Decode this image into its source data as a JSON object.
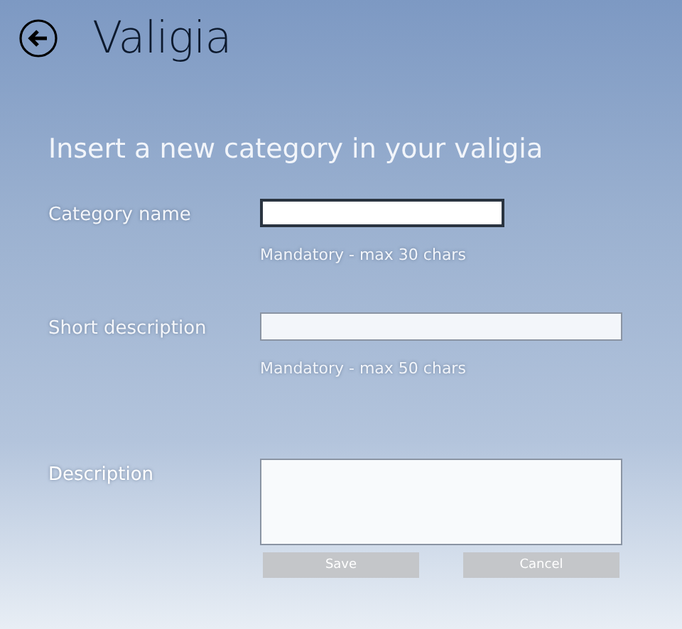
{
  "header": {
    "title": "Valigia"
  },
  "subtitle": "Insert a new category in your valigia",
  "fields": [
    {
      "label": "Category name",
      "kind": "short",
      "focused": true,
      "hint": "Mandatory - max 30 chars"
    },
    {
      "label": "Short description",
      "kind": "wide",
      "focused": false,
      "hint": "Mandatory - max 50 chars"
    },
    {
      "label": "Description",
      "kind": "multiline",
      "focused": false
    }
  ],
  "buttons": [
    "Save",
    "Cancel"
  ]
}
